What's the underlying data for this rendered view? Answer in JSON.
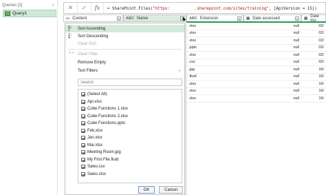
{
  "queries_pane": {
    "header": "Queries [1]",
    "collapse_icon": "chevron-left-icon",
    "items": [
      {
        "label": "Query1",
        "icon": "table-icon"
      }
    ]
  },
  "formula_bar": {
    "cancel_icon": "close-icon",
    "commit_icon": "checkmark-icon",
    "fx_label": "fx",
    "formula_prefix": "= SharePoint.Files(",
    "formula_string_1": "\"https:",
    "formula_string_2": ".sharepoint.com/sites/training\"",
    "formula_suffix": ", [ApiVersion = 15])"
  },
  "columns": [
    {
      "label": "Content",
      "type_icon": "binary-icon",
      "type_glyph": "▭",
      "filter_icon": "dropdown-icon"
    },
    {
      "label": "Name",
      "type_icon": "text-type-icon",
      "type_glyph": "ABC",
      "filter_icon": "dropdown-icon",
      "active": true
    },
    {
      "label": "Extension",
      "type_icon": "text-type-icon",
      "type_glyph": "ABC",
      "filter_icon": "dropdown-icon"
    },
    {
      "label": "Date accessed",
      "type_icon": "datetime-icon",
      "type_glyph": "▦",
      "filter_icon": "dropdown-icon"
    },
    {
      "label": "Date mo",
      "type_icon": "datetime-icon",
      "type_glyph": "▦",
      "filter_icon": "dropdown-icon"
    }
  ],
  "rows": [
    {
      "extension": ".xlsx",
      "date_accessed": "null",
      "date_modified": "02/"
    },
    {
      "extension": ".xlsx",
      "date_accessed": "null",
      "date_modified": "02/"
    },
    {
      "extension": ".xlsx",
      "date_accessed": "null",
      "date_modified": "02/"
    },
    {
      "extension": ".pptx",
      "date_accessed": "null",
      "date_modified": "02/"
    },
    {
      "extension": ".xlsx",
      "date_accessed": "null",
      "date_modified": "02/"
    },
    {
      "extension": ".csv",
      "date_accessed": "null",
      "date_modified": "02/"
    },
    {
      "extension": ".jpg",
      "date_accessed": "null",
      "date_modified": "16/"
    },
    {
      "extension": ".fluid",
      "date_accessed": "null",
      "date_modified": "16/"
    },
    {
      "extension": ".xlsx",
      "date_accessed": "null",
      "date_modified": "16/"
    },
    {
      "extension": ".xlsx",
      "date_accessed": "null",
      "date_modified": "16/"
    },
    {
      "extension": ".xlsx",
      "date_accessed": "null",
      "date_modified": "16/"
    }
  ],
  "dropdown": {
    "sort_ascending": "Sort Ascending",
    "sort_descending": "Sort Descending",
    "clear_sort": "Clear Sort",
    "clear_filter": "Clear Filter",
    "remove_empty": "Remove Empty",
    "text_filters": "Text Filters",
    "search_placeholder": "Search",
    "items": [
      "(Select All)",
      "Apr.xlsx",
      "Cube Functions 1.xlsx",
      "Cube Functions 2.xlsx",
      "Cube Functions.pptx",
      "Feb.xlsx",
      "Jan.xlsx",
      "Mar.xlsx",
      "Meeting Room.jpg",
      "My First File.fluid",
      "Sales.csv",
      "Sales.xlsx"
    ],
    "ok_label": "OK",
    "cancel_label": "Cancel"
  },
  "colors": {
    "accent_green": "#1e9b54",
    "highlight_green": "#d4ebdc"
  }
}
